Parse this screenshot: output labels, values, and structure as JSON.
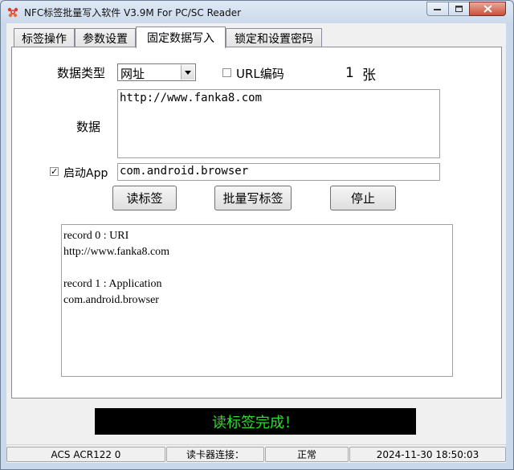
{
  "window": {
    "title": "NFC标签批量写入软件 V3.9M For PC/SC Reader",
    "icons": [
      "app-icon",
      "minimize-icon",
      "maximize-icon",
      "close-icon"
    ]
  },
  "tabs": [
    {
      "label": "标签操作",
      "active": false
    },
    {
      "label": "参数设置",
      "active": false
    },
    {
      "label": "固定数据写入",
      "active": true
    },
    {
      "label": "锁定和设置密码",
      "active": false
    }
  ],
  "form": {
    "data_type_label": "数据类型",
    "data_type_value": "网址",
    "url_encode_label": "URL编码",
    "url_encode_checked": false,
    "count_value": "1",
    "count_unit": "张",
    "data_label": "数据",
    "data_value": "http://www.fanka8.com",
    "launch_app_label": "启动App",
    "launch_app_checked": true,
    "launch_app_value": "com.android.browser"
  },
  "buttons": {
    "read": "读标签",
    "batch_write": "批量写标签",
    "stop": "停止"
  },
  "log": [
    "record 0 : URI",
    "http://www.fanka8.com",
    "",
    "record 1 : Application",
    "com.android.browser"
  ],
  "status_message": "读标签完成！",
  "status_message_color": "#2edc2e",
  "statusbar": {
    "reader": "ACS ACR122 0",
    "connection_label": "读卡器连接：",
    "connection_state": "正常",
    "datetime": "2024-11-30 18:50:03"
  }
}
